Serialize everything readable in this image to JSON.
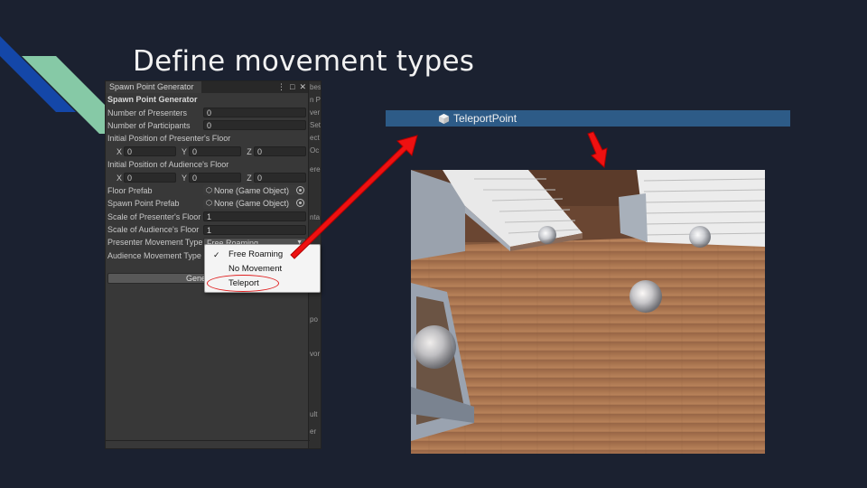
{
  "slide": {
    "title": "Define movement types"
  },
  "panel": {
    "tab_title": "Spawn Point Generator",
    "tab_actions": [
      "⋮",
      "□",
      "✕"
    ],
    "section_header": "Spawn Point Generator",
    "fields": {
      "num_presenters_label": "Number of Presenters",
      "num_presenters_value": "0",
      "num_participants_label": "Number of Participants",
      "num_participants_value": "0",
      "presenter_floor_pos_label": "Initial Position of Presenter's Floor",
      "presenter_floor_x": "0",
      "presenter_floor_y": "0",
      "presenter_floor_z": "0",
      "audience_floor_pos_label": "Initial Position of Audience's Floor",
      "audience_floor_x": "0",
      "audience_floor_y": "0",
      "audience_floor_z": "0",
      "floor_prefab_label": "Floor Prefab",
      "floor_prefab_value": "None (Game Object)",
      "spawn_point_prefab_label": "Spawn Point Prefab",
      "spawn_point_prefab_value": "None (Game Object)",
      "scale_presenter_label": "Scale of Presenter's Floor",
      "scale_presenter_value": "1",
      "scale_audience_label": "Scale of Audience's Floor",
      "scale_audience_value": "1",
      "presenter_movement_label": "Presenter Movement Type",
      "presenter_movement_value": "Free Roaming",
      "audience_movement_label": "Audience Movement Type",
      "generate_button_label": "Generate S"
    },
    "axis_labels": {
      "x": "X",
      "y": "Y",
      "z": "Z"
    },
    "side_strip_text": [
      "bes",
      "n P",
      "ver",
      "Set",
      "ect",
      "Oc",
      "ere",
      "nta",
      "po",
      "vor",
      "ult",
      "er"
    ]
  },
  "dropdown": {
    "options": [
      "Free Roaming",
      "No Movement",
      "Teleport"
    ],
    "selected": "Free Roaming",
    "check_mark": "✓"
  },
  "hierarchy": {
    "item_label": "TeleportPoint"
  },
  "colors": {
    "background": "#1b2130",
    "accent_blue": "#1447a8",
    "accent_green": "#7fc4a0",
    "arrow_red": "#ee1111",
    "highlight_ellipse": "#e02020",
    "hierarchy_selected": "#2d5b87"
  }
}
